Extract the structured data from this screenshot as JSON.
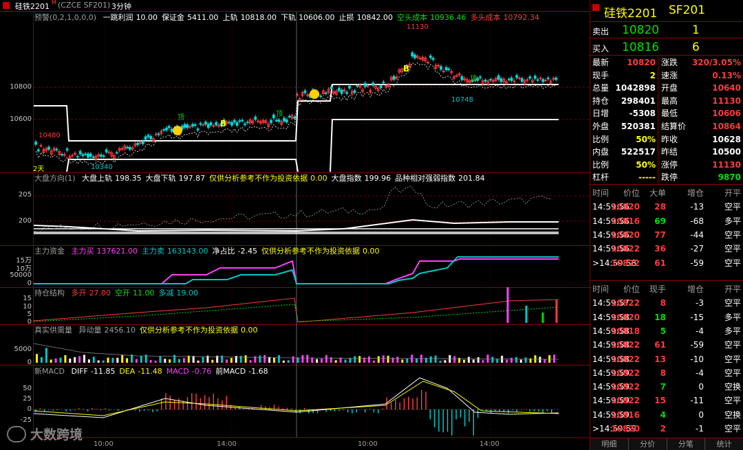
{
  "window": {
    "title": "硅铁2201",
    "title_mark": "M",
    "code": "(CZCE SF201)",
    "period": "3分钟"
  },
  "main": {
    "indicator": "预警(0,2,1,0,0,0)",
    "stats": [
      {
        "label": "一跳利润",
        "value": "10.00",
        "color": "#ffffff"
      },
      {
        "label": "保证金",
        "value": "5411.00",
        "color": "#ffffff"
      },
      {
        "label": "上轨",
        "value": "10818.00",
        "color": "#ffffff"
      },
      {
        "label": "下轨",
        "value": "10606.00",
        "color": "#ffffff"
      },
      {
        "label": "止损",
        "value": "10842.00",
        "color": "#ffffff"
      },
      {
        "label": "空头成本",
        "value": "10936.46",
        "color": "#00e000"
      },
      {
        "label": "多头成本",
        "value": "10792.34",
        "color": "#ff3b3b"
      }
    ],
    "y_ticks": [
      "10800",
      "10600"
    ],
    "annotations": [
      "11130",
      "10748",
      "10480",
      "10340",
      "2天",
      "顶",
      "顶",
      "顶",
      "B",
      "B"
    ]
  },
  "panel2": {
    "name": "大盘方向(1)",
    "stats": [
      {
        "label": "大盘上轨",
        "value": "198.35",
        "color": "#ffffff"
      },
      {
        "label": "大盘下轨",
        "value": "197.87",
        "color": "#ffffff"
      },
      {
        "label": "仅供分析参考不作为投资依据",
        "value": "0.00",
        "color": "#ffff00"
      },
      {
        "label": "大盘指数",
        "value": "199.96",
        "color": "#ffffff"
      },
      {
        "label": "品种相对强弱指数",
        "value": "201.84",
        "color": "#ffffff"
      }
    ],
    "y_ticks": [
      "205",
      "200"
    ]
  },
  "panel3": {
    "name": "主力资金",
    "stats": [
      {
        "label": "主力买",
        "value": "137621.00",
        "color": "#ff40ff"
      },
      {
        "label": "主力卖",
        "value": "163143.00",
        "color": "#00c8c8"
      },
      {
        "label": "净占比",
        "value": "-2.45",
        "color": "#ffffff"
      },
      {
        "label": "仅供分析参考不作为投资依据",
        "value": "0.00",
        "color": "#ffff00"
      }
    ],
    "y_ticks": [
      "15万",
      "10万",
      "50000",
      "0"
    ]
  },
  "panel4": {
    "name": "持仓结构",
    "stats": [
      {
        "label": "多开",
        "value": "27.00",
        "color": "#ff3b3b"
      },
      {
        "label": "空开",
        "value": "11.00",
        "color": "#00e000"
      },
      {
        "label": "多减",
        "value": "19.00",
        "color": "#00c8c8"
      }
    ],
    "y_ticks": [
      "15",
      "10",
      "5",
      "0"
    ]
  },
  "panel5": {
    "name": "真实供需量",
    "stats": [
      {
        "label": "异动量",
        "value": "2456.10",
        "color": "#a0a0a0"
      },
      {
        "label": "仅供分析参考不作为投资依据",
        "value": "0.00",
        "color": "#ffff00"
      }
    ],
    "y_ticks": [
      "5000",
      "0"
    ]
  },
  "panel6": {
    "name": "新MACD",
    "stats": [
      {
        "label": "DIFF",
        "value": "-11.85",
        "color": "#ffffff"
      },
      {
        "label": "DEA",
        "value": "-11.48",
        "color": "#ffff00"
      },
      {
        "label": "MACD",
        "value": "-0.76",
        "color": "#ff40ff"
      },
      {
        "label": "前MACD",
        "value": "-1.68",
        "color": "#ffffff"
      }
    ],
    "y_ticks": [
      "50",
      "25",
      "0",
      "-25"
    ]
  },
  "x_axis": [
    "10:00",
    "14:00",
    "10:00",
    "14:00"
  ],
  "watermark": "大数跨境",
  "quote": {
    "name": "硅铁2201",
    "code": "SF201",
    "sell": {
      "label": "卖出",
      "price": "10820",
      "vol": "1"
    },
    "buy": {
      "label": "买入",
      "price": "10816",
      "vol": "6"
    },
    "rows": [
      {
        "l1": "最新",
        "v1": "10820",
        "c1": "#ff3b3b",
        "l2": "涨跌",
        "v2": "320/3.05%",
        "c2": "#ff3b3b"
      },
      {
        "l1": "现手",
        "v1": "2",
        "c1": "#ffff00",
        "l2": "速涨",
        "v2": "0.13%",
        "c2": "#ff3b3b"
      },
      {
        "l1": "总量",
        "v1": "1042898",
        "c1": "#ffffff",
        "l2": "开盘",
        "v2": "10640",
        "c2": "#ff3b3b"
      },
      {
        "l1": "持仓",
        "v1": "298401",
        "c1": "#ffffff",
        "l2": "最高",
        "v2": "11130",
        "c2": "#ff3b3b"
      },
      {
        "l1": "日增",
        "v1": "-5308",
        "c1": "#ffffff",
        "l2": "最低",
        "v2": "10606",
        "c2": "#ff3b3b"
      },
      {
        "l1": "外盘",
        "v1": "520381",
        "c1": "#ffffff",
        "l2": "结算价",
        "v2": "10864",
        "c2": "#ff3b3b"
      },
      {
        "l1": "比例",
        "v1": "50%",
        "c1": "#ffff00",
        "l2": "昨收",
        "v2": "10628",
        "c2": "#ffffff"
      },
      {
        "l1": "内盘",
        "v1": "522517",
        "c1": "#ffffff",
        "l2": "昨结",
        "v2": "10500",
        "c2": "#ffffff"
      },
      {
        "l1": "比例",
        "v1": "50%",
        "c1": "#ffff00",
        "l2": "涨停",
        "v2": "11130",
        "c2": "#ff3b3b"
      },
      {
        "l1": "杠杆",
        "v1": "-----",
        "c1": "#ffff00",
        "l2": "跌停",
        "v2": "9870",
        "c2": "#00e000"
      }
    ],
    "ticks1_header": [
      "时间",
      "价位",
      "大单",
      "增仓",
      "开平"
    ],
    "ticks1": [
      {
        "t": "14:59:56",
        "p": "10820",
        "v": "28",
        "vc": "#ff3b3b",
        "d": "-13",
        "k": "空平"
      },
      {
        "t": "14:59:56",
        "p": "10816",
        "v": "69",
        "vc": "#00e000",
        "d": "-68",
        "k": "多平"
      },
      {
        "t": "14:59:56",
        "p": "10820",
        "v": "77",
        "vc": "#ff3b3b",
        "d": "-44",
        "k": "空平"
      },
      {
        "t": "14:59:56",
        "p": "10822",
        "v": "36",
        "vc": "#ff3b3b",
        "d": "-27",
        "k": "空平"
      },
      {
        "t": ">14:59:58",
        "p": "10822",
        "v": "61",
        "vc": "#ff3b3b",
        "d": "-59",
        "k": "空平"
      }
    ],
    "ticks2_header": [
      "时间",
      "价位",
      "现手",
      "增仓",
      "开平"
    ],
    "ticks2": [
      {
        "t": "14:59:57",
        "p": "10822",
        "v": "8",
        "vc": "#ff3b3b",
        "d": "-3",
        "k": "空平"
      },
      {
        "t": "14:59:58",
        "p": "10820",
        "v": "18",
        "vc": "#00e000",
        "d": "-15",
        "k": "多平"
      },
      {
        "t": "14:59:58",
        "p": "10818",
        "v": "5",
        "vc": "#00e000",
        "d": "-4",
        "k": "多平"
      },
      {
        "t": "14:59:58",
        "p": "10822",
        "v": "61",
        "vc": "#ff3b3b",
        "d": "-59",
        "k": "空平"
      },
      {
        "t": "14:59:58",
        "p": "10822",
        "v": "13",
        "vc": "#ff3b3b",
        "d": "-10",
        "k": "空平"
      },
      {
        "t": "14:59:59",
        "p": "10822",
        "v": "8",
        "vc": "#ff3b3b",
        "d": "-4",
        "k": "空平"
      },
      {
        "t": "14:59:59",
        "p": "10822",
        "v": "7",
        "vc": "#00e000",
        "d": "0",
        "k": "空换"
      },
      {
        "t": "14:59:59",
        "p": "10822",
        "v": "15",
        "vc": "#ff3b3b",
        "d": "-11",
        "k": "空平"
      },
      {
        "t": "14:59:59",
        "p": "10816",
        "v": "4",
        "vc": "#00e000",
        "d": "0",
        "k": "空换"
      },
      {
        "t": ">14:59:59",
        "p": "10820",
        "v": "2",
        "vc": "#ff3b3b",
        "d": "-1",
        "k": "空平"
      }
    ],
    "tabs": [
      "明细",
      "分价",
      "分笔",
      "统计"
    ]
  }
}
